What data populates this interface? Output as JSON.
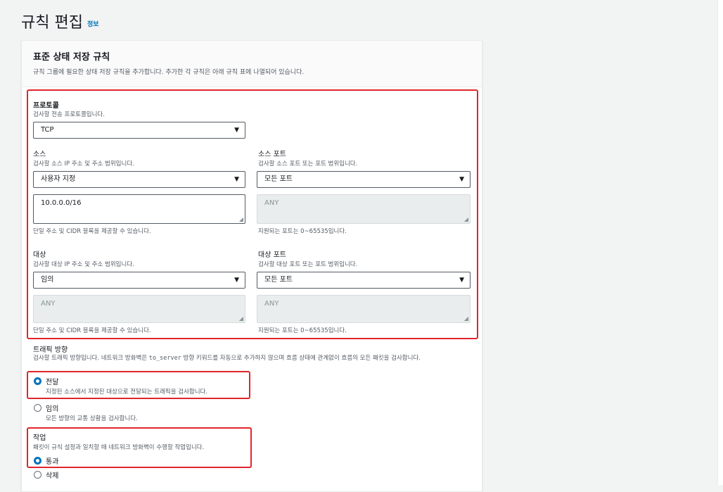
{
  "page": {
    "title": "규칙 편집",
    "info_link": "정보"
  },
  "panel": {
    "title": "표준 상태 저장 규칙",
    "description": "규칙 그룹에 필요한 상태 저장 규칙을 추가합니다. 추가한 각 규칙은 아래 규칙 표에 나열되어 있습니다."
  },
  "protocol": {
    "label": "프로토콜",
    "description": "검사할 전송 프로토콜입니다.",
    "value": "TCP"
  },
  "source": {
    "label": "소스",
    "description": "검사할 소스 IP 주소 및 주소 범위입니다.",
    "select_value": "사용자 지정",
    "textarea_value": "10.0.0.0/16",
    "hint": "단일 주소 및 CIDR 블록을 제공할 수 있습니다."
  },
  "source_port": {
    "label": "소스 포트",
    "description": "검사할 소스 포트 또는 포트 범위입니다.",
    "select_value": "모든 포트",
    "textarea_value": "ANY",
    "hint": "지원되는 포트는 0~65535입니다."
  },
  "destination": {
    "label": "대상",
    "description": "검사할 대상 IP 주소 및 주소 범위입니다.",
    "select_value": "임의",
    "textarea_value": "ANY",
    "hint": "단일 주소 및 CIDR 블록을 제공할 수 있습니다."
  },
  "destination_port": {
    "label": "대상 포트",
    "description": "검사할 대상 포트 또는 포트 범위입니다.",
    "select_value": "모든 포트",
    "textarea_value": "ANY",
    "hint": "지원되는 포트는 0~65535입니다."
  },
  "traffic_direction": {
    "label": "트래픽 방향",
    "description_before": "검사할 트래픽 방향입니다. 네트워크 방화벽은 ",
    "description_code": "to_server",
    "description_after": " 방향 키워드를 자동으로 추가하지 않으며 흐름 상태에 관계없이 흐름의 모든 패킷을 검사합니다.",
    "options": [
      {
        "label": "전달",
        "description": "지정된 소스에서 지정된 대상으로 전달되는 트래픽을 검사합니다.",
        "checked": true
      },
      {
        "label": "임의",
        "description": "모든 방향의 교통 상황을 검사합니다.",
        "checked": false
      }
    ]
  },
  "action": {
    "label": "작업",
    "description": "패킷이 규칙 설정과 일치할 때 네트워크 방화벽이 수행할 작업입니다.",
    "options": [
      {
        "label": "통과",
        "checked": true
      },
      {
        "label": "삭제",
        "checked": false
      }
    ]
  },
  "icons": {
    "dropdown": "caret-down-icon",
    "resize": "resize-grip-icon"
  },
  "colors": {
    "accent": "#0073bb",
    "highlight": "#e0262b",
    "background": "#f2f3f3"
  },
  "glyphs": {
    "caret": "▼",
    "grip": "◢"
  }
}
